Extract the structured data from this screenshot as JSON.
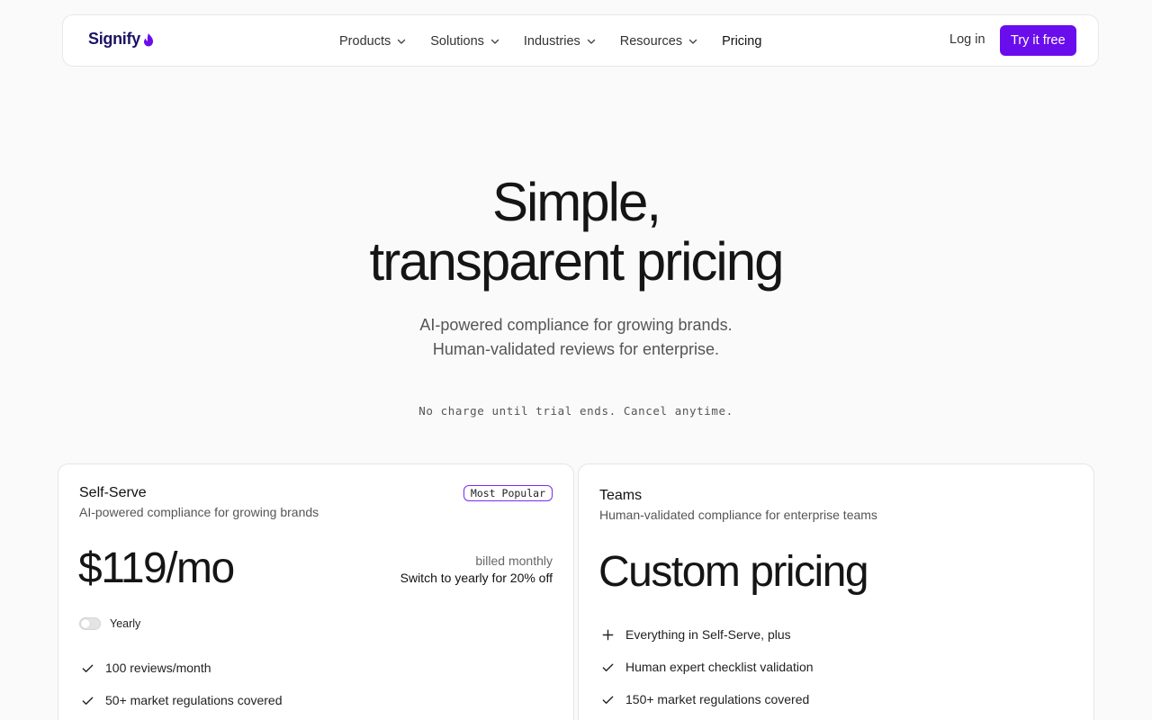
{
  "brand": {
    "name": "Signify",
    "icon": "flame-icon",
    "color": "#1b1464"
  },
  "nav": {
    "links": [
      {
        "label": "Products",
        "dropdown": true
      },
      {
        "label": "Solutions",
        "dropdown": true
      },
      {
        "label": "Industries",
        "dropdown": true
      },
      {
        "label": "Resources",
        "dropdown": true
      },
      {
        "label": "Pricing",
        "dropdown": false
      }
    ],
    "login_label": "Log in",
    "cta_label": "Try it free",
    "accent_color": "#6a0dec"
  },
  "hero": {
    "title_line1": "Simple,",
    "title_line2": "transparent pricing",
    "subtitle_line1": "AI-powered compliance for growing brands.",
    "subtitle_line2": "Human-validated reviews for enterprise.",
    "note": "No charge until trial ends. Cancel anytime."
  },
  "plans": {
    "self_serve": {
      "name": "Self-Serve",
      "description": "AI-powered compliance for growing brands",
      "badge": "Most Popular",
      "price": "$119/mo",
      "billing_note": "billed monthly",
      "yearly_offer": "Switch to yearly for 20% off",
      "toggle_label": "Yearly",
      "toggle_on": false,
      "features": [
        {
          "icon": "check-icon",
          "text": "100 reviews/month"
        },
        {
          "icon": "check-icon",
          "text": "50+ market regulations covered"
        }
      ]
    },
    "teams": {
      "name": "Teams",
      "description": "Human-validated compliance for enterprise teams",
      "price": "Custom pricing",
      "features": [
        {
          "icon": "plus-icon",
          "text": "Everything in Self-Serve, plus"
        },
        {
          "icon": "check-icon",
          "text": "Human expert checklist validation"
        },
        {
          "icon": "check-icon",
          "text": "150+ market regulations covered"
        }
      ]
    }
  }
}
